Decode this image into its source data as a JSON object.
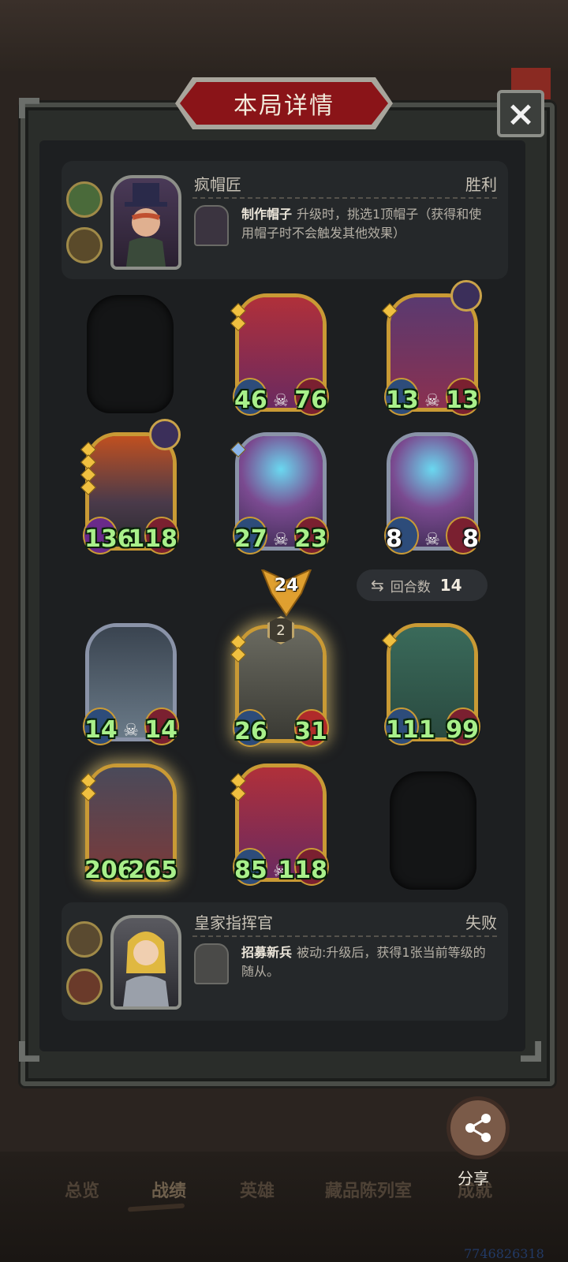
{
  "title": "本局详情",
  "close_label": "×",
  "top_player": {
    "name": "疯帽匠",
    "result": "胜利",
    "skill_name": "制作帽子",
    "skill_desc": "升级时，挑选1顶帽子（获得和使用帽子时不会触发其他效果）"
  },
  "board": {
    "row1": [
      {
        "atk": "46",
        "hp": "76"
      },
      {
        "atk": "13",
        "hp": "13"
      }
    ],
    "row2": [
      {
        "atk": "136",
        "hp": "118"
      },
      {
        "atk": "27",
        "hp": "23"
      },
      {
        "atk": "8",
        "hp": "8"
      }
    ],
    "damage": "24",
    "round_label": "回合数",
    "round_value": "14",
    "row3": [
      {
        "atk": "14",
        "hp": "14"
      },
      {
        "atk": "26",
        "hp": "31",
        "level": "2"
      },
      {
        "atk": "111",
        "hp": "99"
      }
    ],
    "row4": [
      {
        "atk": "206",
        "hp": "265"
      },
      {
        "atk": "85",
        "hp": "118"
      }
    ]
  },
  "bottom_player": {
    "name": "皇家指挥官",
    "result": "失败",
    "skill_name": "招募新兵",
    "skill_desc": "被动:升级后，获得1张当前等级的随从。"
  },
  "share_label": "分享",
  "tabs": [
    "总览",
    "战绩",
    "英雄",
    "藏品陈列室",
    "成就"
  ],
  "watermark": "7746826318",
  "colors": {
    "accent_red": "#8a1418",
    "stat_green": "#a8f08a",
    "gold_frame": "#c99a35"
  }
}
